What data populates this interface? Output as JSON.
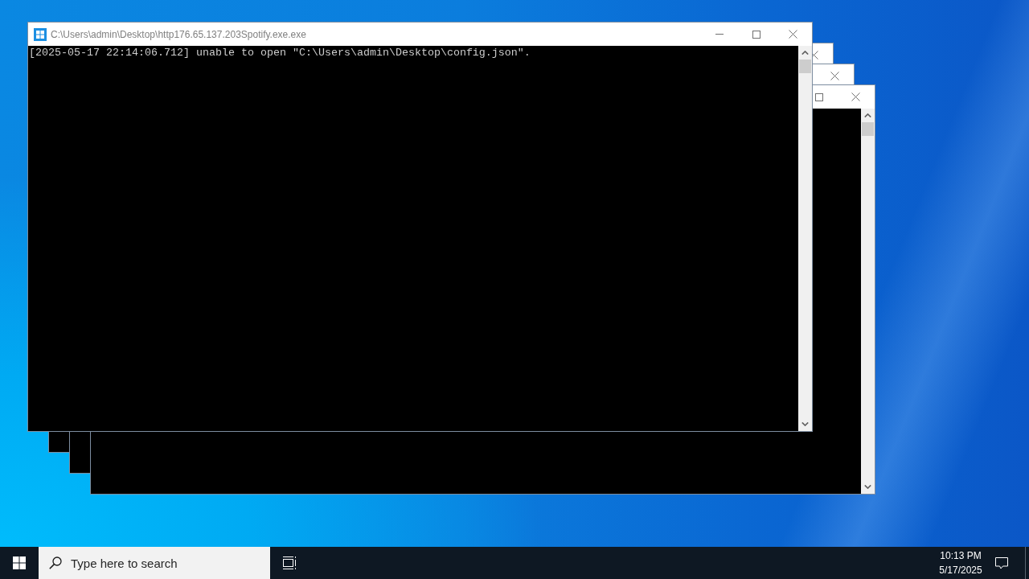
{
  "windows": [
    {
      "title": "C:\\Users\\admin\\Desktop\\http176.65.137.203Spotify.exe.exe",
      "controls": [
        {
          "kind": "minimize"
        },
        {
          "kind": "maximize"
        },
        {
          "kind": "close"
        }
      ],
      "scrollbar": true,
      "lines": [
        "[2025-05-17 22:14:06.712] unable to open \"C:\\Users\\admin\\Desktop\\config.json\"."
      ]
    },
    {
      "controls": [
        {
          "kind": "close"
        }
      ]
    },
    {
      "controls": [
        {
          "kind": "close"
        }
      ]
    },
    {
      "controls": [
        {
          "kind": "maximize"
        },
        {
          "kind": "close"
        }
      ],
      "scrollbar": true
    }
  ],
  "taskbar": {
    "search": {
      "placeholder": "Type here to search"
    },
    "clock": {
      "time": "10:13 PM",
      "date": "5/17/2025"
    }
  }
}
